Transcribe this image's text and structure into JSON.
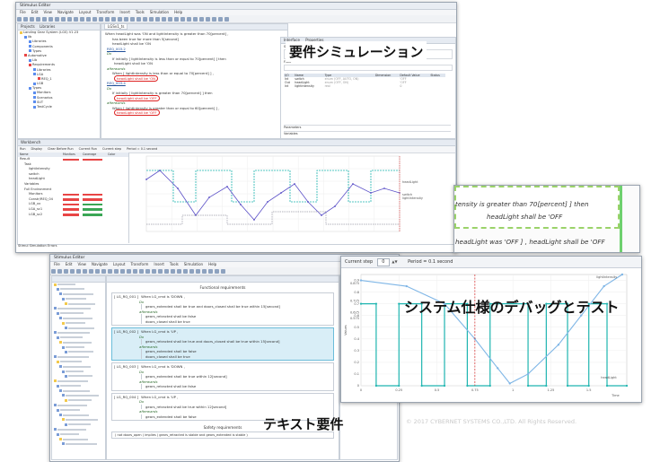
{
  "captions": {
    "req_sim": "要件シミュレーション",
    "debug": "システム仕様のデバッグとテスト",
    "text_req": "テキスト要件"
  },
  "copyright": "© 2017 CYBERNET SYSTEMS CO.,LTD. All Rights Reserved.",
  "win1": {
    "title": "Stimulus Editor",
    "menu": [
      "File",
      "Edit",
      "View",
      "Navigate",
      "Layout",
      "Transform",
      "Insert",
      "Tools",
      "Simulation",
      "Help"
    ],
    "tabs": [
      "Projects",
      "Libraries"
    ],
    "tree": [
      "Landing Gear System (LGS) V1.23",
      "lib",
      "Libraries",
      "Components",
      "Types",
      "Automotive",
      "Lib",
      "Requirements",
      "Libraries",
      "LGA",
      "REQ_1",
      "LGB",
      "Types",
      "Monitors",
      "Scenarios",
      "SUT",
      "TestCycle"
    ],
    "editor_tab": "LGSv1_ts",
    "requirements": [
      {
        "line": "When   headLight  was  'ON  and  lightIntensity  is greater than  70[percent] ,"
      },
      {
        "line": "has been true for more than  5[second]"
      },
      {
        "line": "headLight  shall be  'ON"
      },
      {
        "line": "REQ_003.2"
      },
      {
        "line": "Do"
      },
      {
        "line": "If initially  [ lightIntensity  is less than or equal to  70[percent] ]  then"
      },
      {
        "line": "headLight  shall be  'ON"
      },
      {
        "line": "afterwards"
      },
      {
        "line": "When  [ lightIntensity  is less than or equal to  70[percent] ] ,"
      },
      {
        "line": "headLight  shall be  'ON"
      },
      {
        "line": "REQ_003.4"
      },
      {
        "line": "Do"
      },
      {
        "line": "If initially  [ lightIntensity  is greater than  70[percent] ]  then"
      },
      {
        "line": "headLight  shall be  'OFF"
      },
      {
        "line": "afterwards"
      },
      {
        "line": "When  [ lightIntensity  is greater than or equal to  60[percent] ] ,"
      },
      {
        "line": "headLight  shall be  'OFF"
      }
    ],
    "interface": {
      "tabs": [
        "Interface",
        "Properties"
      ],
      "system_label": "System",
      "filter_label": "Filter",
      "columns": [
        "I/O",
        "Name",
        "Type",
        "Dimension",
        "Default Value",
        "Status"
      ],
      "rows": [
        [
          "Int",
          "switch",
          "enum (OFF, AUTO, ON)",
          "",
          "'OFF",
          ""
        ],
        [
          "Out",
          "headLight",
          "enum (OFF, ON)",
          "",
          "'OFF",
          ""
        ],
        [
          "Int",
          "lightIntensity",
          "real",
          "",
          "0",
          ""
        ]
      ],
      "sections": [
        "Parameters",
        "Variables"
      ]
    },
    "workbench": {
      "title": "Workbench",
      "controls": [
        "Run",
        "Display",
        "Clear Before Run",
        "Current Run",
        "Current step",
        "Period = 0.1 second"
      ],
      "cols": [
        "Name",
        "Monitors",
        "Coverage",
        "Color"
      ],
      "items": [
        "Result",
        "Task",
        "lightIntensity",
        "switch",
        "headLight",
        "Variables",
        "Full Environment",
        "Monitors",
        "Constr/REQ_04",
        "LGB_xx",
        "LGA_sc1",
        "LGB_sc2"
      ]
    },
    "plot_legend": [
      "headLight",
      "switch",
      "lightIntensity"
    ],
    "status_tab": "Stimul Simulation Errors"
  },
  "win2": {
    "title": "Stimulus Editor",
    "menu": [
      "File",
      "Edit",
      "View",
      "Navigate",
      "Layout",
      "Transform",
      "Insert",
      "Tools",
      "Simulation",
      "Help"
    ],
    "section_title": "Functional requirements",
    "reqs": [
      {
        "id": "[ LG_RQ_001 ]",
        "cond": "When   LG_cmd  is   'DOWN  ,",
        "lines": [
          "Do",
          "gears_extended  shall be  true  and  doors_closed  shall be  true  within  15[second]",
          "afterwards",
          "gears_retracted  shall be  false",
          "doors_closed  shall be  true"
        ]
      },
      {
        "id": "[ LG_RQ_002 ]",
        "cond": "When   LG_cmd  is   'UP  ,",
        "lines": [
          "Do",
          "gears_retracted  shall be  true  and  doors_closed  shall be  true  within  15[second]",
          "afterwards",
          "gears_extended  shall be  false",
          "doors_closed  shall be  true"
        ]
      },
      {
        "id": "[ LG_RQ_003 ]",
        "cond": "When   LG_cmd  is   'DOWN  ,",
        "lines": [
          "Do",
          "gears_extended  shall be  true  within  12[second]",
          "afterwards",
          "gears_retracted  shall be  false"
        ]
      },
      {
        "id": "[ LG_RQ_004 ]",
        "cond": "When   LG_cmd  is   'UP  ,",
        "lines": [
          "Do",
          "gears_retracted  shall be  true  within  12[second]",
          "afterwards",
          "gears_extended  shall be  false"
        ]
      }
    ],
    "safety_title": "Safety requirements",
    "safety_line": "( not  doors_open  ) implies  ( gears_retracted  is stable  and  gears_extended  is stable )"
  },
  "win3": {
    "lines": [
      "tensity  is greater than  70[percent] ]  then",
      "headLight  shall be  'OFF",
      "headLight  was  'OFF ] ,     headLight  shall be  'OFF"
    ]
  },
  "win4": {
    "step_label": "Current step",
    "step_value": "0",
    "period": "Period = 0.1 second",
    "yticks": [
      "0.9",
      "0.8",
      "0.7",
      "0.6",
      "0.5",
      "0.4",
      "0.3",
      "0.2",
      "0.1",
      "0"
    ],
    "y_extra": [
      "0.875",
      "0.725",
      "0.625",
      "0.575"
    ],
    "xticks": [
      "0",
      "0.25",
      "0.5",
      "0.75",
      "1",
      "1.25",
      "1.5"
    ],
    "xlabel": "Time",
    "ylabel": "Values",
    "legend": [
      "lightIntensity",
      "headLight"
    ]
  },
  "colors": {
    "teal": "#1fb5b0",
    "purple": "#5a4fc7",
    "grey": "#9a9aa8",
    "red": "#d62828"
  }
}
